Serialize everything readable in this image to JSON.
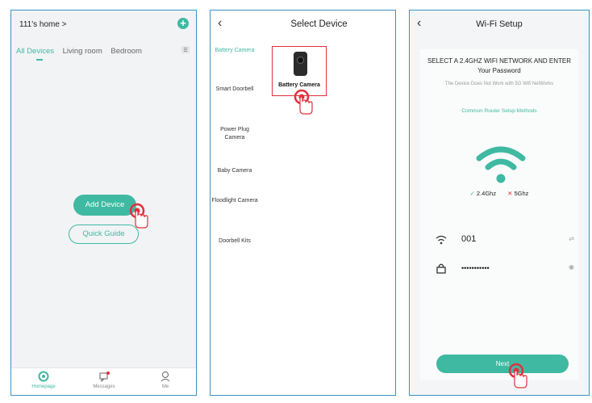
{
  "panel1": {
    "home_title": "111's home >",
    "plus_icon": "plus-circle-icon",
    "tabs": [
      {
        "label": "All Devices",
        "active": true
      },
      {
        "label": "Living room",
        "active": false
      },
      {
        "label": "Bedroom",
        "active": false
      }
    ],
    "add_device_label": "Add Device",
    "quick_guide_label": "Quick Guide",
    "nav": [
      {
        "label": "Homepage",
        "icon": "home-icon",
        "active": true
      },
      {
        "label": "Messages",
        "icon": "messages-icon",
        "active": false
      },
      {
        "label": "Me",
        "icon": "user-icon",
        "active": false
      }
    ]
  },
  "panel2": {
    "title": "Select Device",
    "categories": [
      {
        "label": "Battery Camera",
        "active": true
      },
      {
        "label": "Smart Doorbell",
        "active": false
      },
      {
        "label": "Power Plug Camera",
        "active": false
      },
      {
        "label": "Baby Camera",
        "active": false
      },
      {
        "label": "Floodlight Camera",
        "active": false
      },
      {
        "label": "Doorbell Kits",
        "active": false
      }
    ],
    "selected_device_label": "Battery Camera"
  },
  "panel3": {
    "title": "Wi-Fi Setup",
    "heading": "SELECT A 2.4GHZ WIFI NETWORK AND ENTER Your Password",
    "note": "The Device Does Not Work with 5G Wifi NetWorks",
    "link": "Common Router Setup Methods",
    "band_ok": "2.4Ghz",
    "band_no": "5Ghz",
    "ssid": "001",
    "password": "•••••••••••",
    "next_label": "Next"
  },
  "colors": {
    "accent": "#3fb9a2",
    "highlight": "#e2313b",
    "frame": "#3a93c4"
  }
}
